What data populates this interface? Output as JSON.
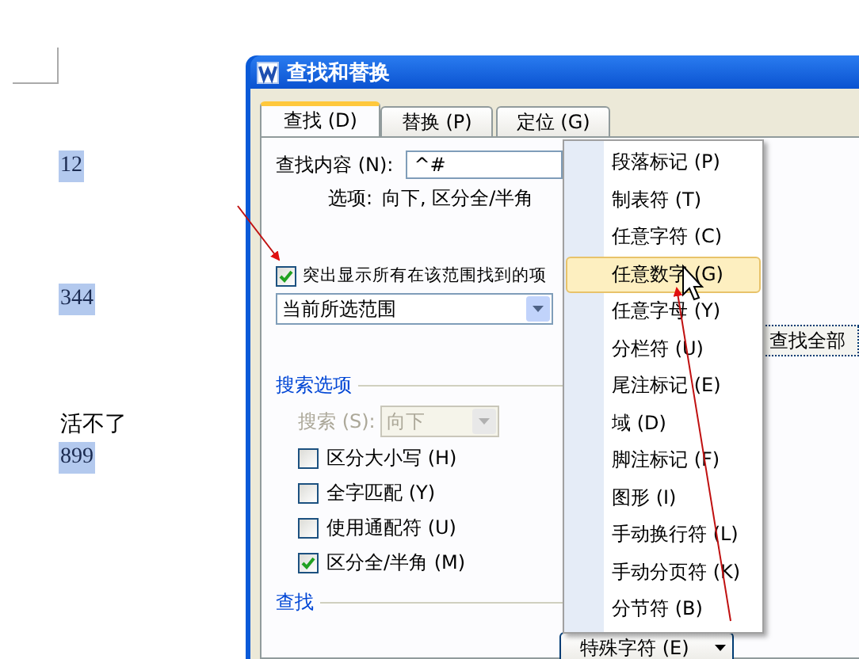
{
  "document": {
    "paragraphs": [
      {
        "text": "12",
        "selected": true
      },
      {
        "text": "344",
        "selected": true
      },
      {
        "text": "活不了",
        "selected": false
      },
      {
        "text": "899",
        "selected": true
      }
    ]
  },
  "dialog": {
    "title": "查找和替换",
    "tabs": [
      {
        "label": "查找 (D)",
        "selected": true
      },
      {
        "label": "替换 (P)",
        "selected": false
      },
      {
        "label": "定位 (G)",
        "selected": false
      }
    ],
    "find_what": {
      "label": "查找内容 (N):",
      "value": "^#"
    },
    "options": {
      "label": "选项:",
      "value": "向下, 区分全/半角"
    },
    "highlight_all": {
      "label": "突出显示所有在该范围找到的项",
      "checked": true
    },
    "scope": {
      "value": "当前所选范围"
    },
    "find_all_button": "查找全部",
    "search_options": {
      "title": "搜索选项",
      "direction": {
        "label": "搜索 (S):",
        "value": "向下",
        "disabled": true
      },
      "checkboxes": [
        {
          "label": "区分大小写 (H)",
          "checked": false
        },
        {
          "label": "全字匹配 (Y)",
          "checked": false
        },
        {
          "label": "使用通配符 (U)",
          "checked": false
        },
        {
          "label": "区分全/半角 (M)",
          "checked": true
        }
      ]
    },
    "find_section": {
      "title": "查找"
    },
    "special_button": "特殊字符 (E)",
    "special_menu": {
      "items": [
        {
          "label": "段落标记 (P)",
          "selected": false
        },
        {
          "label": "制表符 (T)",
          "selected": false
        },
        {
          "label": "任意字符 (C)",
          "selected": false
        },
        {
          "label": "任意数字 (G)",
          "selected": true
        },
        {
          "label": "任意字母 (Y)",
          "selected": false
        },
        {
          "label": "分栏符 (U)",
          "selected": false
        },
        {
          "label": "尾注标记 (E)",
          "selected": false
        },
        {
          "label": "域 (D)",
          "selected": false
        },
        {
          "label": "脚注标记 (F)",
          "selected": false
        },
        {
          "label": "图形 (I)",
          "selected": false
        },
        {
          "label": "手动换行符 (L)",
          "selected": false
        },
        {
          "label": "手动分页符 (K)",
          "selected": false
        },
        {
          "label": "分节符 (B)",
          "selected": false
        }
      ]
    }
  }
}
